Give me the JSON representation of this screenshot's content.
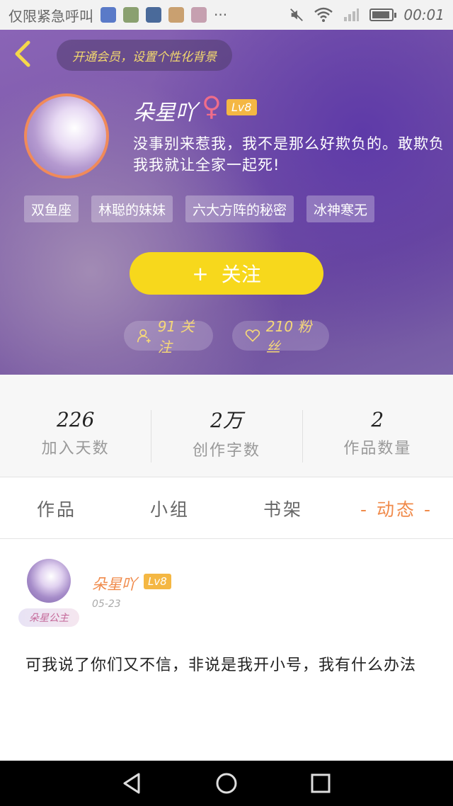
{
  "status_bar": {
    "carrier": "仅限紧急呼叫",
    "more": "···",
    "time": "00:01"
  },
  "header": {
    "back_icon": "chevron-left-icon",
    "vip_prompt": "开通会员，设置个性化背景",
    "nickname": "朵星吖",
    "gender_symbol": "♀",
    "level": "Lv8",
    "bio": "没事别来惹我，我不是那么好欺负的。敢欺负我我就让全家一起死!",
    "tags": [
      "双鱼座",
      "林聪的妹妹",
      "六大方阵的秘密",
      "冰神寒无"
    ],
    "follow_plus": "+",
    "follow_label": "关注",
    "following_count": "91 关注",
    "fans_count": "210 粉丝",
    "colors": {
      "accent_yellow": "#f7d81c",
      "header_purple": "#7a58a8"
    }
  },
  "stats": [
    {
      "value": "226",
      "label": "加入天数"
    },
    {
      "value": "2万",
      "label": "创作字数"
    },
    {
      "value": "2",
      "label": "作品数量"
    }
  ],
  "tabs": [
    {
      "label": "作品"
    },
    {
      "label": "小组"
    },
    {
      "label": "书架"
    },
    {
      "label": "- 动态 -",
      "active": true
    }
  ],
  "post": {
    "author": "朵星吖",
    "level": "Lv8",
    "frame_label": "朵星公主",
    "date": "05-23",
    "text": "可我说了你们又不信，非说是我开小号，我有什么办法"
  },
  "navbar": {
    "back": "triangle-back-icon",
    "home": "circle-home-icon",
    "recent": "square-recent-icon"
  }
}
